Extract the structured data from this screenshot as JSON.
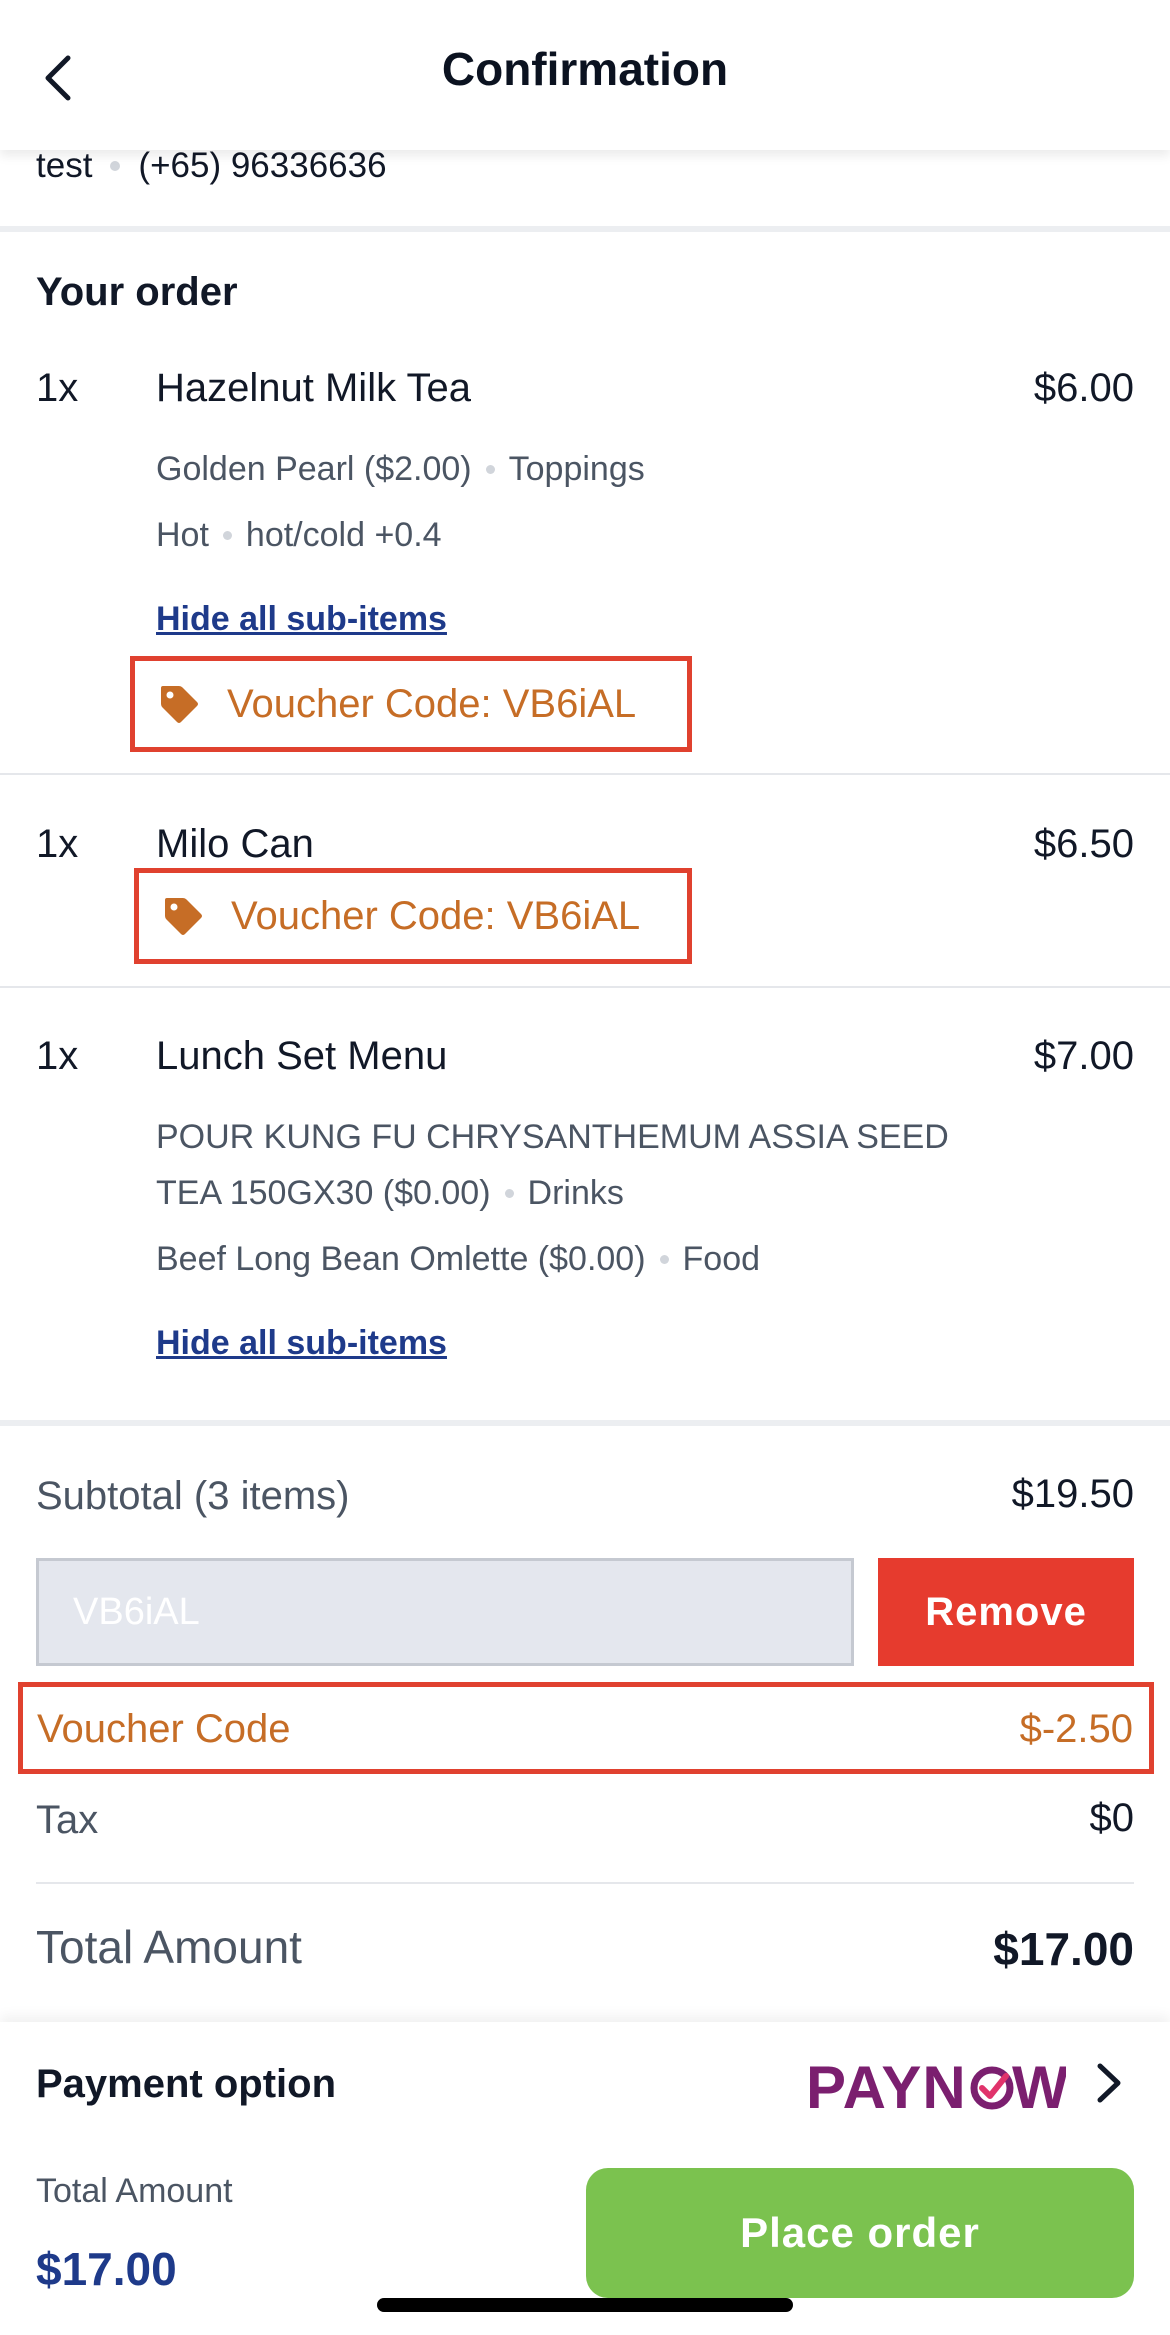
{
  "header": {
    "title": "Confirmation",
    "back_icon": "chevron-left-icon"
  },
  "contact": {
    "name": "test",
    "phone": "(+65) 96336636"
  },
  "order": {
    "title": "Your order",
    "items": [
      {
        "qty": "1x",
        "name": "Hazelnut Milk Tea",
        "price": "$6.00",
        "options": [
          {
            "value": "Golden Pearl ($2.00)",
            "group": "Toppings"
          },
          {
            "value": "Hot",
            "group": "hot/cold +0.4"
          }
        ],
        "hide_link": "Hide all sub-items",
        "voucher": "Voucher Code: VB6iAL"
      },
      {
        "qty": "1x",
        "name": "Milo Can",
        "price": "$6.50",
        "voucher": "Voucher Code: VB6iAL"
      },
      {
        "qty": "1x",
        "name": "Lunch Set Menu",
        "price": "$7.00",
        "options": [
          {
            "value_line1": "POUR KUNG FU CHRYSANTHEMUM ASSIA SEED",
            "value_line2": "TEA 150GX30 ($0.00)",
            "group": "Drinks"
          },
          {
            "value": "Beef Long Bean Omlette ($0.00)",
            "group": "Food"
          }
        ],
        "hide_link": "Hide all sub-items"
      }
    ]
  },
  "summary": {
    "subtotal_label": "Subtotal (3 items)",
    "subtotal_value": "$19.50",
    "voucher_input_value": "VB6iAL",
    "remove_label": "Remove",
    "voucher_label": "Voucher Code",
    "voucher_value": "$-2.50",
    "tax_label": "Tax",
    "tax_value": "$0",
    "total_label": "Total Amount",
    "total_value": "$17.00"
  },
  "payment": {
    "label": "Payment option",
    "method_logo": "PAYNOW",
    "total_label": "Total Amount",
    "total_value": "$17.00",
    "place_order_label": "Place order"
  },
  "colors": {
    "accent_blue": "#1e3a8a",
    "voucher_orange": "#c66d26",
    "highlight_red": "#e0412f",
    "remove_red": "#e63b2e",
    "place_order_green": "#7bc24f",
    "paynow_purple": "#7b1f6f"
  }
}
